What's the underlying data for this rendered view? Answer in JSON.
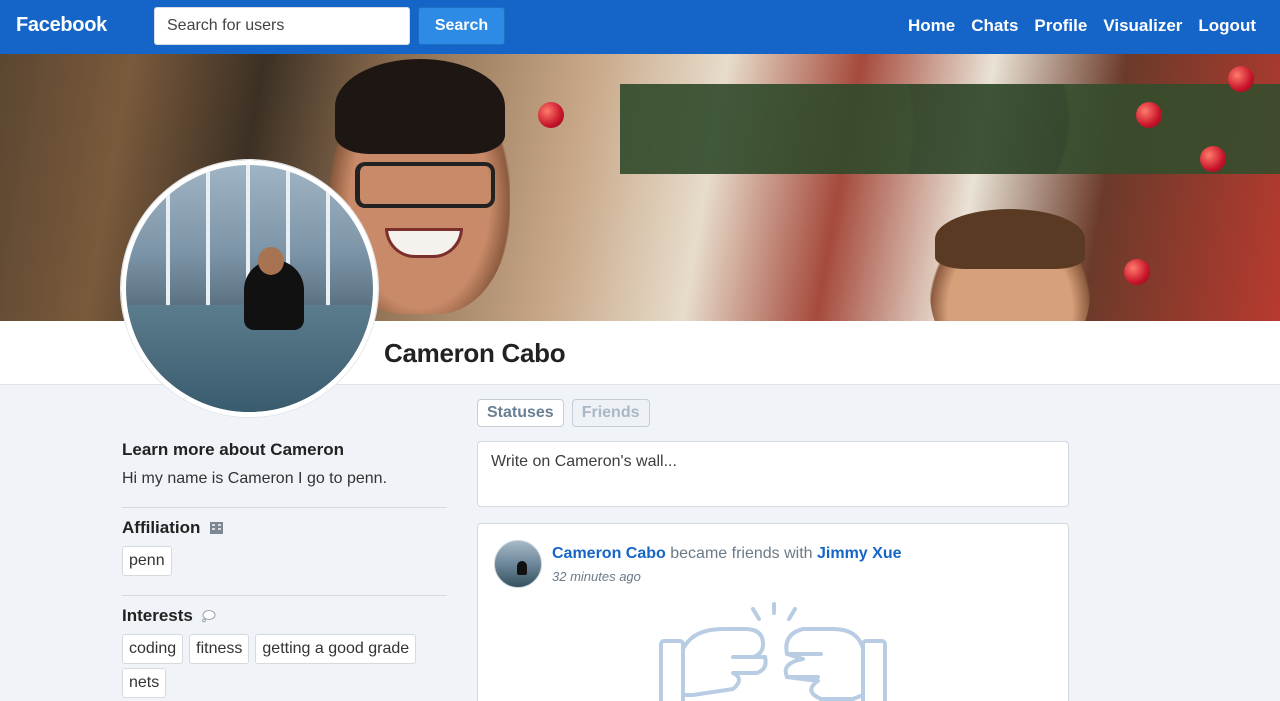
{
  "nav": {
    "brand": "Facebook",
    "search_placeholder": "Search for users",
    "search_button": "Search",
    "links": [
      "Home",
      "Chats",
      "Profile",
      "Visualizer",
      "Logout"
    ]
  },
  "profile": {
    "name": "Cameron Cabo"
  },
  "about": {
    "title": "Learn more about Cameron",
    "text": "Hi my name is Cameron I go to penn."
  },
  "affiliation": {
    "title": "Affiliation",
    "icon": "building-icon",
    "tags": [
      "penn"
    ]
  },
  "interests": {
    "title": "Interests",
    "icon": "thought-bubble-icon",
    "tags": [
      "coding",
      "fitness",
      "getting a good grade",
      "nets"
    ]
  },
  "tabs": [
    "Statuses",
    "Friends"
  ],
  "composer": {
    "placeholder": "Write on Cameron's wall..."
  },
  "post": {
    "actor": "Cameron Cabo",
    "verb": "became friends with",
    "target": "Jimmy Xue",
    "time": "32 minutes ago",
    "icon": "fist-bump-icon"
  },
  "colors": {
    "navbar": "#1565c9",
    "link": "#1565c9",
    "background": "#f0f3f7"
  }
}
